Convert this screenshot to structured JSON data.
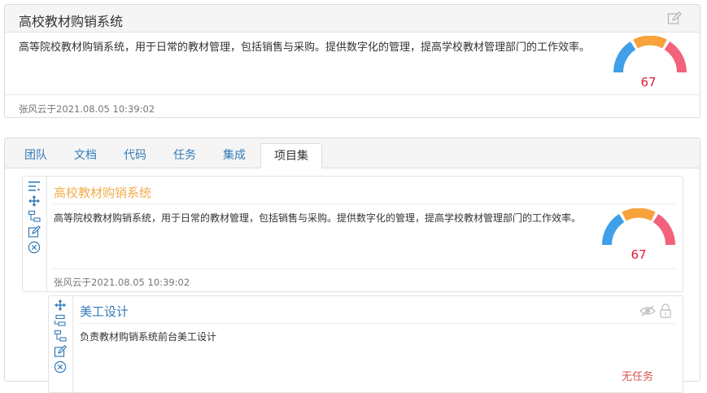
{
  "top_card": {
    "title": "高校教材购销系统",
    "description": "高等院校教材购销系统，用于日常的教材管理，包括销售与采购。提供数字化的管理，提高学校教材管理部门的工作效率。",
    "score": "67",
    "footer": "张风云于2021.08.05 10:39:02"
  },
  "tabs": [
    {
      "label": "团队"
    },
    {
      "label": "文档"
    },
    {
      "label": "代码"
    },
    {
      "label": "任务"
    },
    {
      "label": "集成"
    },
    {
      "label": "项目集"
    }
  ],
  "project_item": {
    "title": "高校教材购销系统",
    "description": "高等院校教材购销系统，用于日常的教材管理，包括销售与采购。提供数字化的管理，提高学校教材管理部门的工作效率。",
    "score": "67",
    "footer": "张风云于2021.08.05 10:39:02"
  },
  "sub_item": {
    "title": "美工设计",
    "description": "负责教材购销系统前台美工设计",
    "note": "无任务"
  },
  "colors": {
    "gauge_blue": "#3f9fe8",
    "gauge_orange": "#f7a23b",
    "gauge_pink": "#f2637b",
    "link_blue": "#337ab7",
    "title_orange": "#f0ad4e",
    "score_red": "#e0203a"
  }
}
